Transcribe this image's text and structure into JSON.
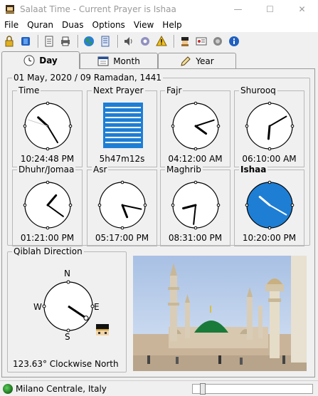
{
  "window": {
    "title": "Salaat Time - Current Prayer is Ishaa",
    "minimize": "—",
    "maximize": "☐",
    "close": "✕"
  },
  "menu": [
    "File",
    "Quran",
    "Duas",
    "Options",
    "View",
    "Help"
  ],
  "toolbar_icons": [
    "lock-icon",
    "book-icon",
    "page-icon",
    "print-icon",
    "globe-icon",
    "list-icon",
    "speaker-icon",
    "settings-icon",
    "warning-icon",
    "user-icon",
    "card-icon",
    "sound-icon",
    "info-icon"
  ],
  "tabs": [
    {
      "label": "Day",
      "icon": "clock-icon",
      "active": true
    },
    {
      "label": "Month",
      "icon": "calendar-icon",
      "active": false
    },
    {
      "label": "Year",
      "icon": "pen-icon",
      "active": false
    }
  ],
  "date_header": "01 May, 2020 / 09 Ramadan, 1441",
  "clocks": [
    {
      "key": "time",
      "label": "Time",
      "value": "10:24:48 PM",
      "hour": 22,
      "minute": 24,
      "second": 48,
      "highlight": false
    },
    {
      "key": "next",
      "label": "Next Prayer",
      "value": "5h47m12s",
      "countdown": true
    },
    {
      "key": "fajr",
      "label": "Fajr",
      "value": "04:12:00 AM",
      "hour": 4,
      "minute": 12,
      "highlight": false
    },
    {
      "key": "shurooq",
      "label": "Shurooq",
      "value": "06:10:00 AM",
      "hour": 6,
      "minute": 10,
      "highlight": false
    },
    {
      "key": "dhuhr",
      "label": "Dhuhr/Jomaa",
      "value": "01:21:00 PM",
      "hour": 13,
      "minute": 21,
      "highlight": false
    },
    {
      "key": "asr",
      "label": "Asr",
      "value": "05:17:00 PM",
      "hour": 17,
      "minute": 17,
      "highlight": false
    },
    {
      "key": "maghrib",
      "label": "Maghrib",
      "value": "08:31:00 PM",
      "hour": 20,
      "minute": 31,
      "highlight": false
    },
    {
      "key": "ishaa",
      "label": "Ishaa",
      "value": "10:20:00 PM",
      "hour": 22,
      "minute": 20,
      "highlight": true
    }
  ],
  "qiblah": {
    "label": "Qiblah Direction",
    "bearing_text": "123.63° Clockwise North",
    "bearing_deg": 123.63,
    "north": "N",
    "south": "S",
    "east": "E",
    "west": "W"
  },
  "status": {
    "location": "Milano Centrale, Italy"
  },
  "colors": {
    "accent": "#1e7ed4",
    "clock_face": "#ffffff",
    "highlight_face": "#1e7ed4"
  }
}
